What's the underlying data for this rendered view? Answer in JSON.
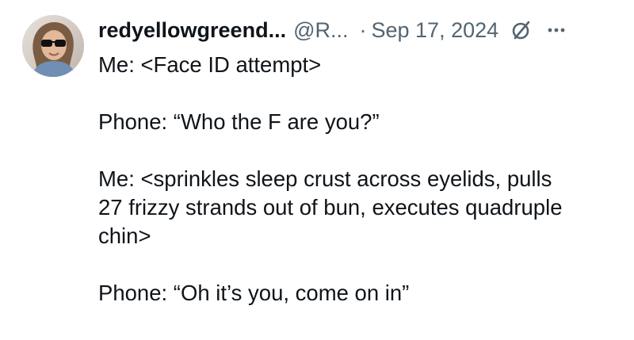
{
  "tweet": {
    "author": {
      "display_name": "redyellowgreend...",
      "handle": "@R...",
      "avatar_icon": "profile-photo-avatar"
    },
    "separator": "·",
    "date": "Sep 17, 2024",
    "icons": {
      "grok": "grok-slash-circle-icon",
      "more": "more-options-icon"
    },
    "text_blocks": [
      {
        "lines": [
          "Me: <Face ID attempt>"
        ]
      },
      {
        "lines": [
          "Phone: “Who the F are you?”"
        ]
      },
      {
        "lines": [
          "Me: <sprinkles sleep crust across eyelids, pulls",
          "27 frizzy strands out of bun, executes quadruple",
          "chin>"
        ]
      },
      {
        "lines": [
          "Phone: “Oh it’s you, come on in”"
        ]
      }
    ]
  },
  "colors": {
    "text_primary": "#0f1419",
    "text_secondary": "#536471",
    "background": "#ffffff"
  }
}
